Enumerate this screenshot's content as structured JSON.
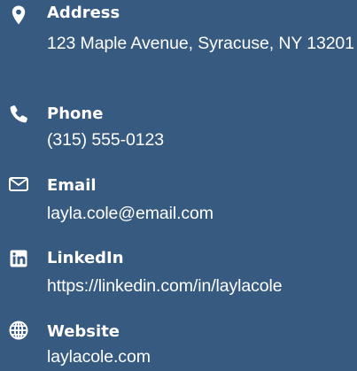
{
  "theme": {
    "background": "#375a80",
    "text": "#ffffff"
  },
  "contact": {
    "items": [
      {
        "icon": "map-marker-icon",
        "label": "Address",
        "value": "123 Maple Avenue, Syracuse, NY 13201"
      },
      {
        "icon": "phone-icon",
        "label": "Phone",
        "value": "(315) 555-0123"
      },
      {
        "icon": "envelope-icon",
        "label": "Email",
        "value": "layla.cole@email.com"
      },
      {
        "icon": "linkedin-icon",
        "label": "LinkedIn",
        "value": "https://linkedin.com/in/laylacole"
      },
      {
        "icon": "globe-icon",
        "label": "Website",
        "value": "laylacole.com"
      }
    ]
  }
}
